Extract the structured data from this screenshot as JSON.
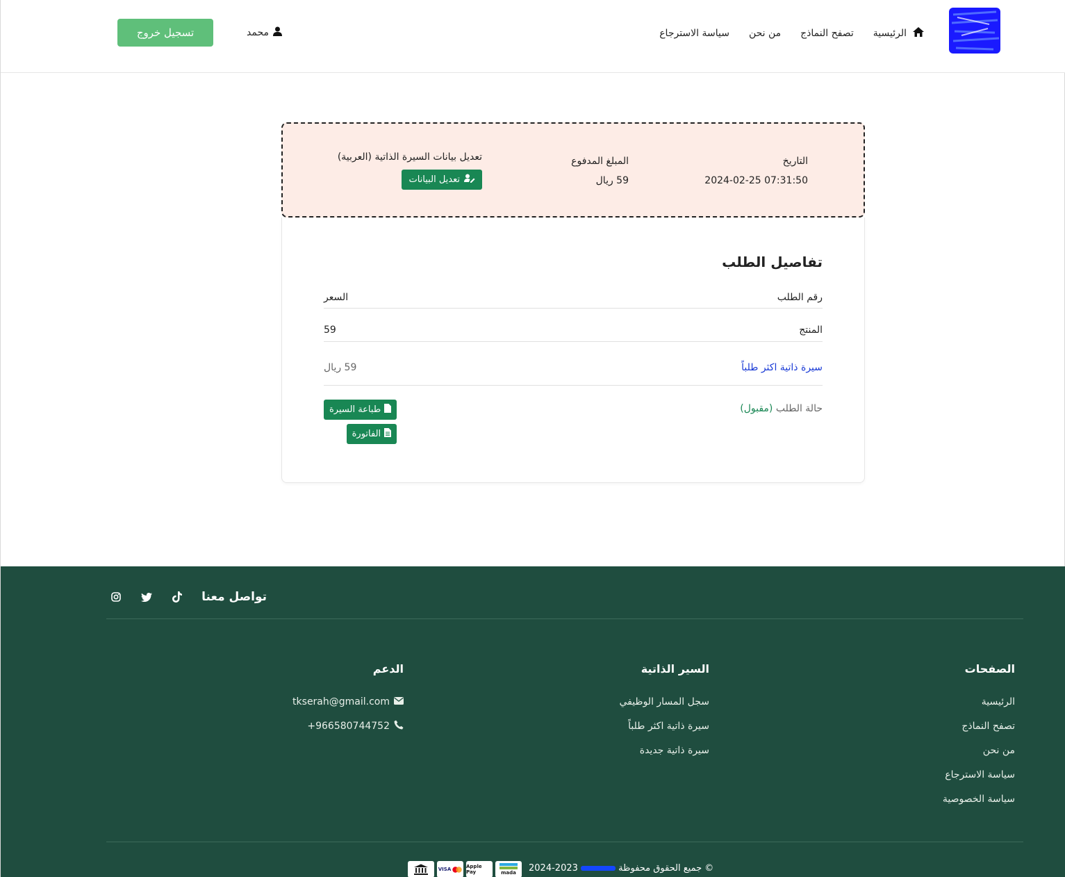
{
  "header": {
    "nav": [
      {
        "label": "الرئيسية",
        "icon": "home-icon"
      },
      {
        "label": "تصفح النماذج"
      },
      {
        "label": "من نحن"
      },
      {
        "label": "سياسة الاسترجاع"
      }
    ],
    "user_name": "محمد",
    "logout_label": "تسجيل خروج"
  },
  "summary": {
    "date_label": "التاريخ",
    "date_value": "2024-02-25 07:31:50",
    "amount_label": "المبلغ المدفوع",
    "amount_value": "59 ريال",
    "edit_title": "تعديل بيانات السيرة الذاتية (العربية)",
    "edit_button": "تعديل البيانات"
  },
  "details": {
    "title": "تفاصيل الطلب",
    "order_number_label": "رقم الطلب",
    "price_label": "السعر",
    "product_label": "المنتج",
    "product_order_value": "59",
    "product_name": "سيرة ذاتية اكثر طلباً",
    "product_price": "59 ريال",
    "status_label": "حالة الطلب",
    "status_value": "(مقبول)",
    "print_button": "طباعة السيرة",
    "invoice_button": "الفاتورة"
  },
  "footer": {
    "contact_title": "تواصل معنا",
    "social_icons": [
      "tiktok-icon",
      "twitter-icon",
      "instagram-icon"
    ],
    "pages": {
      "title": "الصفحات",
      "items": [
        "الرئيسية",
        "تصفح النماذج",
        "من نحن",
        "سياسة الاسترجاع",
        "سياسة الخصوصية"
      ]
    },
    "cvs": {
      "title": "السير الذاتية",
      "items": [
        "سجل المسار الوظيفي",
        "سيرة ذاتية اكثر طلباً",
        "سيرة ذاتية جديدة"
      ]
    },
    "support": {
      "title": "الدعم",
      "email": "tkserah@gmail.com",
      "phone": "966580744752+"
    },
    "copyright_prefix": "© جميع الحقوق محفوظة",
    "copyright_years": "2023-2024",
    "payment_methods": [
      "mada",
      "Apple Pay",
      "VISA",
      "bank"
    ]
  },
  "colors": {
    "primary_green": "#198754",
    "logout_green": "#5fbf7a",
    "footer_bg": "#1f4d3f",
    "summary_bg": "#fdece6",
    "link_blue": "#1a3bd6"
  }
}
